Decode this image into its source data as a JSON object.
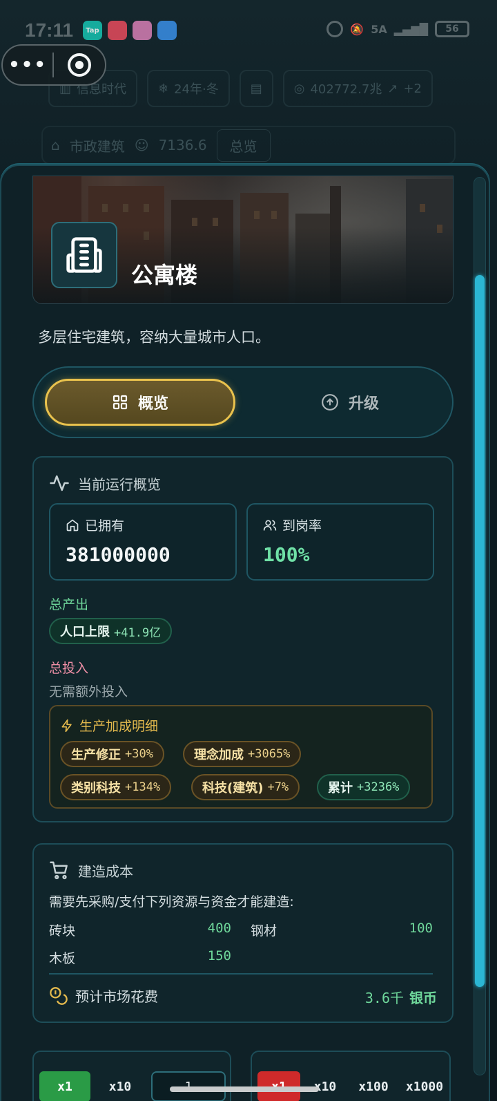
{
  "status": {
    "time": "17:11",
    "apps": [
      {
        "name": "tap",
        "label": "Tap",
        "color": "#17c3b2"
      },
      {
        "name": "read",
        "label": "",
        "color": "#e84b5d"
      },
      {
        "name": "book",
        "label": "",
        "color": "#d77fb5"
      },
      {
        "name": "weather",
        "label": "",
        "color": "#3a8fe8"
      }
    ],
    "network": "5A",
    "battery": "56"
  },
  "background": {
    "era": "信息时代",
    "season": "24年·冬",
    "money": "402772.7兆",
    "money_delta": "+2",
    "nav_title": "市政建筑",
    "nav_count": "7136.6",
    "nav_tab": "总览"
  },
  "building": {
    "title": "公寓楼",
    "description": "多层住宅建筑，容纳大量城市人口。"
  },
  "tabs": {
    "overview": "概览",
    "upgrade": "升级"
  },
  "run": {
    "title": "当前运行概览",
    "owned_label": "已拥有",
    "owned_value": "381000000",
    "rate_label": "到岗率",
    "rate_value": "100%",
    "output_label": "总产出",
    "output_chip_name": "人口上限",
    "output_chip_value": "+41.9亿",
    "input_label": "总投入",
    "input_none": "无需额外投入",
    "bonus_title": "生产加成明细",
    "bonuses": [
      {
        "name": "生产修正",
        "value": "+30%"
      },
      {
        "name": "理念加成",
        "value": "+3065%"
      },
      {
        "name": "类别科技",
        "value": "+134%"
      },
      {
        "name": "科技(建筑)",
        "value": "+7%"
      },
      {
        "name": "累计",
        "value": "+3236%"
      }
    ]
  },
  "cost": {
    "title": "建造成本",
    "note": "需要先采购/支付下列资源与资金才能建造:",
    "resources": [
      {
        "name": "砖块",
        "value": "400"
      },
      {
        "name": "钢材",
        "value": "100"
      },
      {
        "name": "木板",
        "value": "150"
      }
    ],
    "estimate_label": "预计市场花费",
    "estimate_value": "3.6千",
    "estimate_unit": "银币"
  },
  "quantity": {
    "left": {
      "x1": "x1",
      "x10": "x10",
      "input": "1"
    },
    "right": {
      "x1": "x1",
      "x10": "x10",
      "x100": "x100",
      "x1000": "x1000"
    }
  },
  "colors": {
    "accent_gold": "#e9c24d",
    "accent_green": "#6fd89b",
    "accent_pink": "#ef8fa6",
    "scroll": "#2bb6d3"
  }
}
